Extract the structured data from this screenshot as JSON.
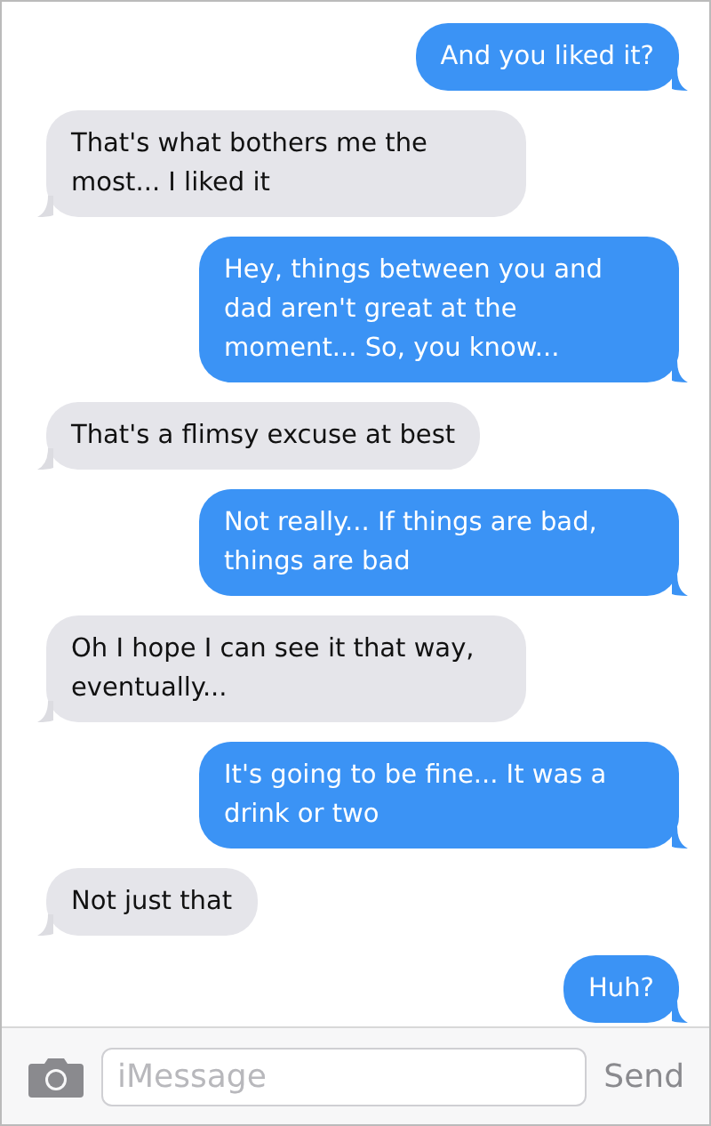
{
  "messages": [
    {
      "kind": "sent",
      "text": "And you liked it?"
    },
    {
      "kind": "received",
      "text": "That's what bothers me the most... I liked it"
    },
    {
      "kind": "sent",
      "text": "Hey, things between you and dad aren't great at the moment... So, you know..."
    },
    {
      "kind": "received",
      "text": "That's a flimsy excuse at best"
    },
    {
      "kind": "sent",
      "text": "Not really... If things are bad, things are bad"
    },
    {
      "kind": "received",
      "text": "Oh I hope I can see it that way, eventually..."
    },
    {
      "kind": "sent",
      "text": "It's going to be fine... It was a drink or two"
    },
    {
      "kind": "received",
      "text": "Not just that"
    },
    {
      "kind": "sent",
      "text": "Huh?"
    }
  ],
  "composer": {
    "placeholder": "iMessage",
    "send": "Send"
  }
}
